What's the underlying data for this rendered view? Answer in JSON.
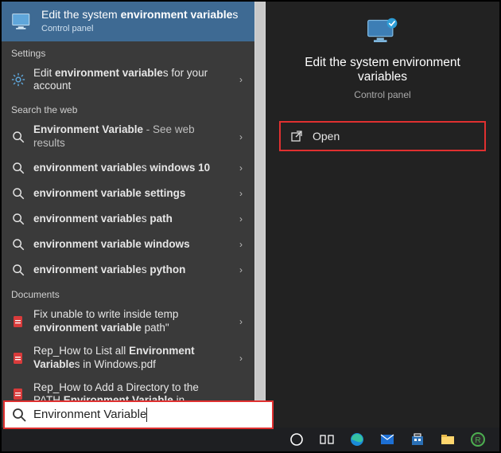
{
  "left": {
    "best_match": {
      "title_pre": "Edit the system ",
      "title_bold": "environment variable",
      "title_post": "s",
      "subtitle": "Control panel"
    },
    "sections": {
      "settings_label": "Settings",
      "search_web_label": "Search the web",
      "documents_label": "Documents"
    },
    "settings_item": {
      "pre": "Edit ",
      "bold": "environment variable",
      "post": "s for your account"
    },
    "web_items": [
      {
        "pre": "",
        "bold": "Environment Variable",
        "post": "",
        "suffix": " - See web results"
      },
      {
        "pre": "",
        "bold": "environment variable",
        "post": "s ",
        "tail_bold": "windows 10"
      },
      {
        "pre": "",
        "bold": "environment variable",
        "post": " ",
        "tail_bold": "settings"
      },
      {
        "pre": "",
        "bold": "environment variable",
        "post": "s ",
        "tail_bold": "path"
      },
      {
        "pre": "",
        "bold": "environment variable",
        "post": " ",
        "tail_bold": "windows"
      },
      {
        "pre": "",
        "bold": "environment variable",
        "post": "s ",
        "tail_bold": "python"
      }
    ],
    "doc_items": [
      {
        "line1": "Fix unable to write inside temp ",
        "bold": "environment variable",
        "line2": " path\""
      },
      {
        "line1": "Rep_How to List all ",
        "bold": "Environment Variable",
        "line2": "s in Windows.pdf"
      },
      {
        "line1": "Rep_How to Add a Directory to the PATH ",
        "bold": "Environment Variable",
        "line2": " in"
      }
    ]
  },
  "right": {
    "title": "Edit the system environment variables",
    "subtitle": "Control panel",
    "action_open": "Open"
  },
  "search_value": "Environment Variable",
  "taskbar": {
    "items": [
      "cortana",
      "task-view",
      "edge",
      "mail",
      "store",
      "explorer",
      "chrome"
    ]
  }
}
